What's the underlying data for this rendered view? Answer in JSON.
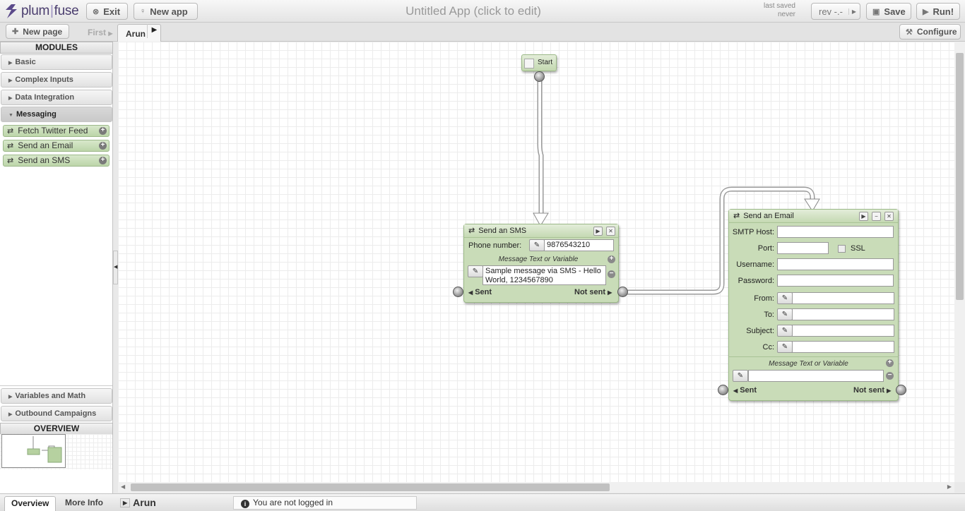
{
  "app": {
    "logo_left": "plum",
    "logo_sep": "|",
    "logo_right": "fuse",
    "title": "Untitled App (click to edit)",
    "last_saved_label": "last saved",
    "last_saved_value": "never"
  },
  "toolbar": {
    "exit_label": "Exit",
    "new_app_label": "New app",
    "rev_label": "rev -.-",
    "save_label": "Save",
    "run_label": "Run!",
    "configure_label": "Configure"
  },
  "pages": {
    "new_page_label": "New page",
    "first_label": "First",
    "tabs": [
      {
        "label": "Arun"
      }
    ]
  },
  "sidebar": {
    "modules_header": "MODULES",
    "accordions": [
      {
        "label": "Basic",
        "expanded": false
      },
      {
        "label": "Complex Inputs",
        "expanded": false
      },
      {
        "label": "Data Integration",
        "expanded": false
      },
      {
        "label": "Messaging",
        "expanded": true
      },
      {
        "label": "Variables and Math",
        "expanded": false
      },
      {
        "label": "Outbound Campaigns",
        "expanded": false
      }
    ],
    "messaging_items": [
      {
        "label": "Fetch Twitter Feed"
      },
      {
        "label": "Send an Email"
      },
      {
        "label": "Send an SMS"
      }
    ],
    "overview_header": "OVERVIEW"
  },
  "canvas": {
    "start_node": {
      "label": "Start"
    },
    "sms_node": {
      "title": "Send an SMS",
      "phone_label": "Phone number:",
      "phone_value": "9876543210",
      "message_header": "Message Text or Variable",
      "message_value": "Sample message via SMS - Hello World, 1234567890",
      "sent_label": "Sent",
      "not_sent_label": "Not sent"
    },
    "email_node": {
      "title": "Send an Email",
      "smtp_host_label": "SMTP Host:",
      "port_label": "Port:",
      "ssl_label": "SSL",
      "username_label": "Username:",
      "password_label": "Password:",
      "from_label": "From:",
      "to_label": "To:",
      "subject_label": "Subject:",
      "cc_label": "Cc:",
      "message_header": "Message Text or Variable",
      "sent_label": "Sent",
      "not_sent_label": "Not sent"
    }
  },
  "bottom": {
    "tab_overview": "Overview",
    "tab_more_info": "More Info",
    "current_page": "Arun",
    "login_notice": "You are not logged in"
  },
  "colors": {
    "node_green": "#c9dcb8",
    "logo_purple": "#4a3d6e"
  },
  "icons": [
    "plumfuse-logo",
    "exit-icon",
    "bulb-icon",
    "plus-icon",
    "save-icon",
    "play-icon",
    "wrench-icon",
    "swap-icon",
    "pencil-icon",
    "info-icon"
  ]
}
